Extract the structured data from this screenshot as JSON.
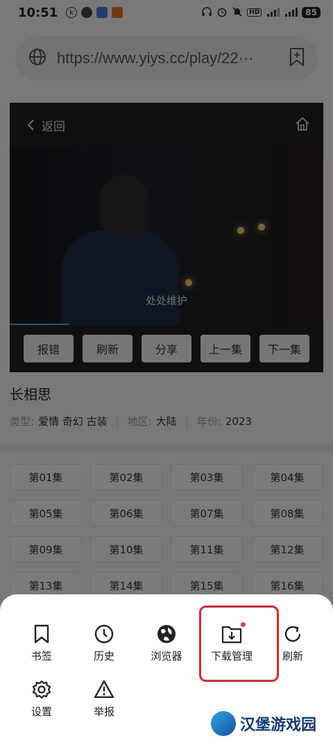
{
  "status_bar": {
    "time": "10:51",
    "battery": "85"
  },
  "url_bar": {
    "url": "https://www.yiys.cc/play/22···"
  },
  "player": {
    "back_label": "返回",
    "subtitle": "处处维护",
    "progress": 0.19,
    "controls": [
      "报错",
      "刷新",
      "分享",
      "上一集",
      "下一集"
    ]
  },
  "show": {
    "title": "长相思",
    "type_label": "类型:",
    "genres": "爱情  奇幻  古装",
    "region_label": "地区:",
    "region": "大陆",
    "year_label": "年份:",
    "year": "2023"
  },
  "episodes": [
    "第01集",
    "第02集",
    "第03集",
    "第04集",
    "第05集",
    "第06集",
    "第07集",
    "第08集",
    "第09集",
    "第10集",
    "第11集",
    "第12集",
    "第13集",
    "第14集",
    "第15集",
    "第16集"
  ],
  "menu": {
    "bookmark": "书签",
    "history": "历史",
    "browser": "浏览器",
    "download": "下载管理",
    "refresh": "刷新",
    "settings": "设置",
    "report": "举报"
  },
  "watermark": "汉堡游戏园",
  "colors": {
    "highlight": "#e2262b",
    "badge": "#e8453c"
  }
}
